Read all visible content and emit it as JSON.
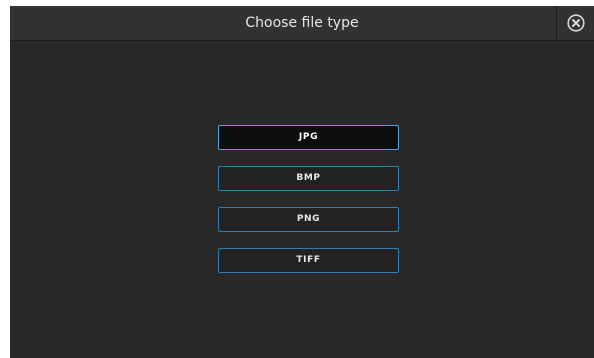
{
  "dialog": {
    "title": "Choose file type",
    "close_icon": "close-circle-icon"
  },
  "file_types": [
    {
      "label": "JPG",
      "selected": true
    },
    {
      "label": "BMP",
      "selected": false
    },
    {
      "label": "PNG",
      "selected": false
    },
    {
      "label": "TIFF",
      "selected": false
    }
  ],
  "colors": {
    "background": "#282828",
    "titlebar": "#323232",
    "accent_border": "#2f7fb0",
    "selected_background": "#0d0d0d"
  }
}
